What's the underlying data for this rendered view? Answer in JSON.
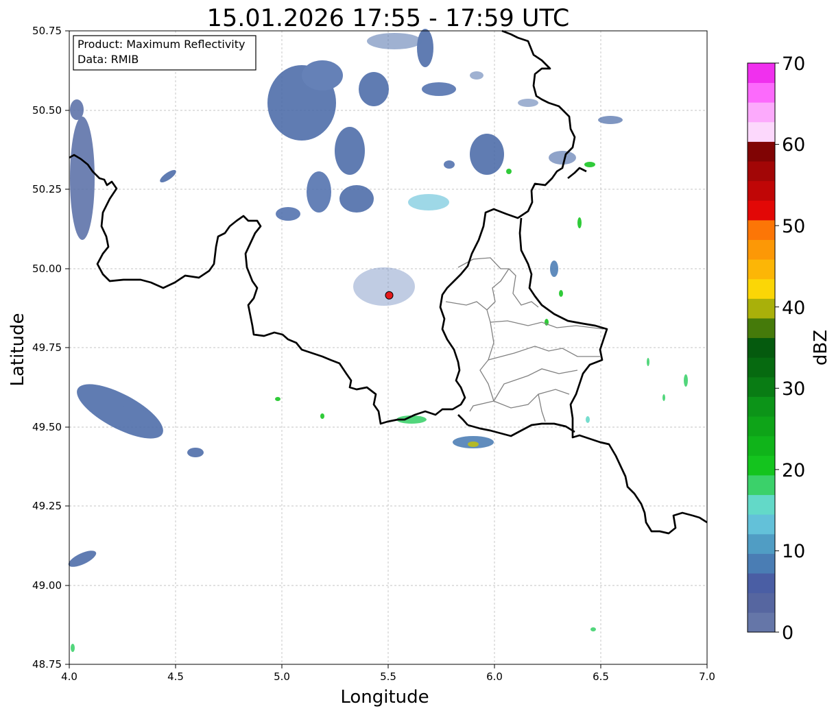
{
  "title": "15.01.2026 17:55 - 17:59 UTC",
  "info_box": {
    "product_line": "Product: Maximum Reflectivity",
    "data_line": "Data: RMIB"
  },
  "x_axis": {
    "label": "Longitude",
    "range": [
      4.0,
      7.0
    ],
    "ticks": [
      "4.0",
      "4.5",
      "5.0",
      "5.5",
      "6.0",
      "6.5",
      "7.0"
    ]
  },
  "y_axis": {
    "label": "Latitude",
    "range": [
      48.75,
      50.75
    ],
    "ticks": [
      "50.75",
      "50.50",
      "50.25",
      "50.00",
      "49.75",
      "49.50",
      "49.25",
      "49.00",
      "48.75"
    ]
  },
  "grid": true,
  "radar_site": {
    "lon": 5.505,
    "lat": 49.915,
    "color": "#e41a1c"
  },
  "colorbar": {
    "label": "dBZ",
    "range": [
      0,
      70
    ],
    "ticks": [
      "0",
      "10",
      "20",
      "30",
      "40",
      "50",
      "60",
      "70"
    ],
    "colors": [
      "#6576a8",
      "#5666a0",
      "#4a5ea4",
      "#4a7db4",
      "#509dc4",
      "#63c1d9",
      "#63d9c8",
      "#3bd16a",
      "#14c41e",
      "#10b41a",
      "#0ea418",
      "#0c9418",
      "#097c14",
      "#066a10",
      "#055a0e",
      "#457a0a",
      "#a9b00a",
      "#fbd606",
      "#fcb606",
      "#fc9806",
      "#fc7606",
      "#e20806",
      "#c00606",
      "#a20606",
      "#800404",
      "#fcd8fc",
      "#fcaafc",
      "#fc6afc",
      "#f030ee"
    ]
  }
}
